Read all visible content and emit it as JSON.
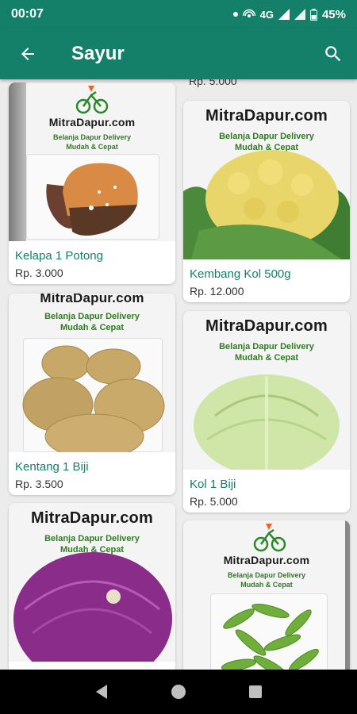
{
  "status_bar": {
    "time": "00:07",
    "network": "4G",
    "battery": "45%"
  },
  "app_bar": {
    "title": "Sayur",
    "back_icon": "arrow-left-icon",
    "search_icon": "search-icon"
  },
  "partial_top_price": "Rp. 5.000",
  "products": [
    {
      "name": "Kelapa 1 Potong",
      "price": "Rp. 3.000",
      "image": "coconut"
    },
    {
      "name": "Kembang Kol 500g",
      "price": "Rp. 12.000",
      "image": "cauliflower"
    },
    {
      "name": "Kentang 1 Biji",
      "price": "Rp. 3.500",
      "image": "potato"
    },
    {
      "name": "Kol 1 Biji",
      "price": "Rp. 5.000",
      "image": "cabbage"
    },
    {
      "name": "",
      "price": "",
      "image": "red-cabbage"
    },
    {
      "name": "",
      "price": "",
      "image": "green-beans"
    }
  ],
  "brand": {
    "name": "MitraDapur.com",
    "tagline_1": "Belanja Dapur Delivery",
    "tagline_2": "Mudah & Cepat"
  },
  "colors": {
    "primary": "#14806a",
    "text_green": "#14806a",
    "tagline_green": "#2f7d1f"
  }
}
